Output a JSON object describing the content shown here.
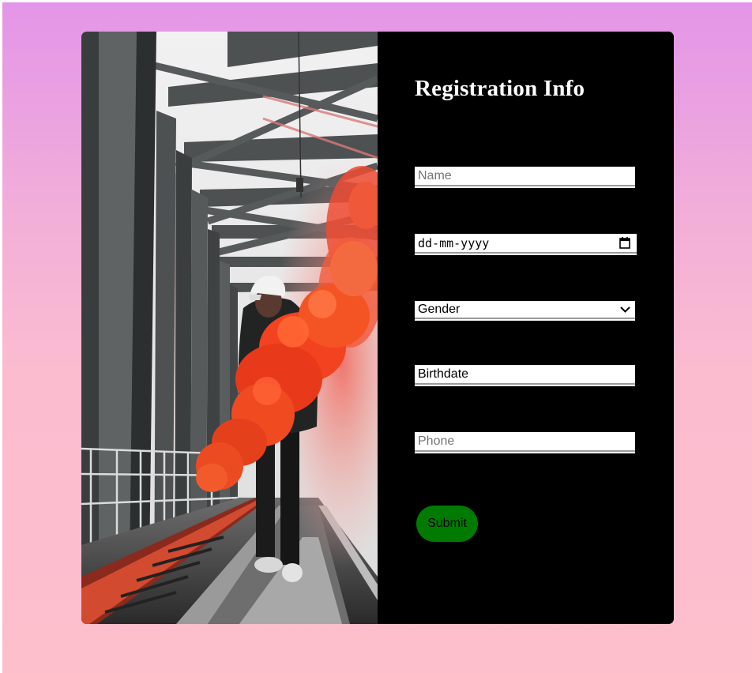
{
  "form": {
    "title": "Registration Info",
    "name_placeholder": "Name",
    "date_placeholder": "dd-mm-yyyy",
    "gender_selected": "Gender",
    "birthdate_value": "Birthdate",
    "phone_placeholder": "Phone",
    "submit_label": "Submit"
  },
  "photo": {
    "subject": "person holding red smoke flare on railway bridge"
  },
  "colors": {
    "background_top": "#e395e8",
    "background_bottom": "#fdbfcc",
    "panel": "#000000",
    "title": "#ffffff",
    "submit": "#007a00"
  },
  "icons": {
    "date": "calendar-icon",
    "gender": "chevron-down-icon"
  }
}
